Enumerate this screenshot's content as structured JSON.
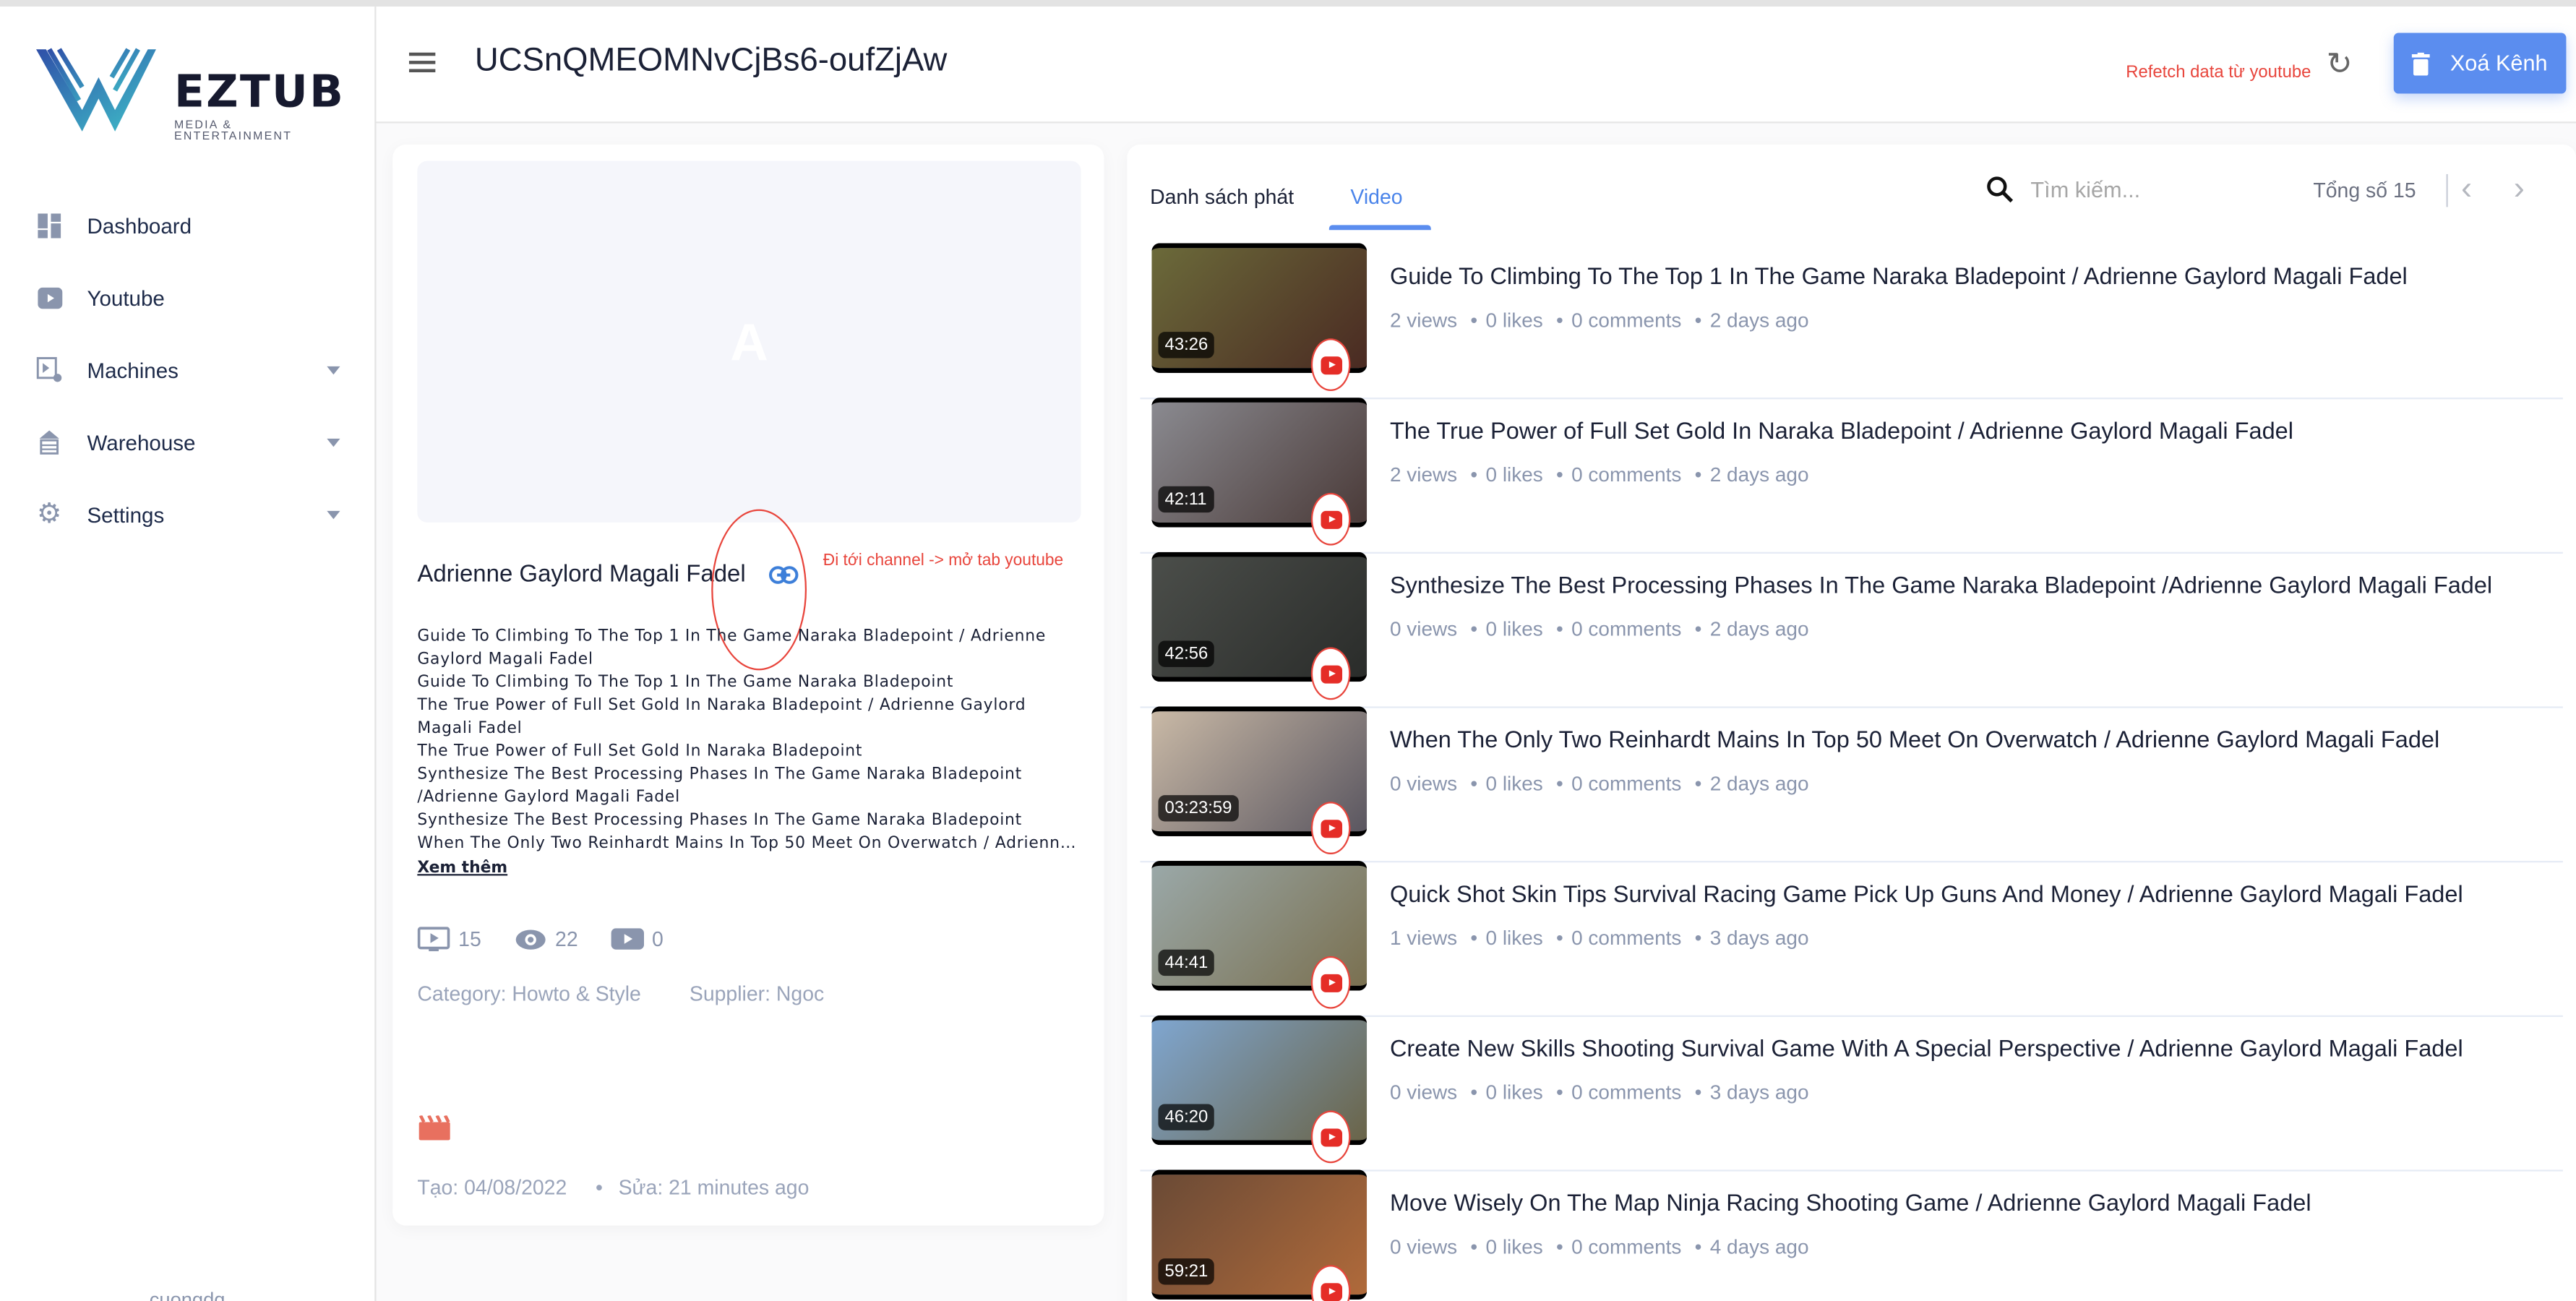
{
  "sidebar": {
    "logo": {
      "name": "EZTUB",
      "tagline": "MEDIA & ENTERTAINMENT"
    },
    "items": [
      {
        "label": "Dashboard",
        "icon": "dashboard-icon"
      },
      {
        "label": "Youtube",
        "icon": "youtube-icon"
      },
      {
        "label": "Machines",
        "icon": "machines-icon",
        "expandable": true
      },
      {
        "label": "Warehouse",
        "icon": "warehouse-icon",
        "expandable": true
      },
      {
        "label": "Settings",
        "icon": "gear-icon",
        "expandable": true
      }
    ],
    "user": "cuongdq"
  },
  "header": {
    "title": "UCSnQMEOMNvCjBs6-oufZjAw",
    "refetch_note": "Refetch data từ youtube",
    "delete_label": "Xoá Kênh"
  },
  "channel": {
    "avatar_letter": "A",
    "name": "Adrienne Gaylord Magali Fadel",
    "link_note": "Đi tới channel -> mở tab youtube",
    "description_lines": [
      "Guide To Climbing To The Top 1 In The Game Naraka Bladepoint / Adrienne",
      "Gaylord Magali Fadel",
      "Guide To Climbing To The Top 1 In The Game Naraka Bladepoint",
      "The True Power of Full Set Gold In Naraka Bladepoint / Adrienne Gaylord",
      "Magali Fadel",
      "The True Power of Full Set Gold In Naraka Bladepoint",
      "Synthesize The Best Processing Phases In The Game Naraka Bladepoint",
      "/Adrienne Gaylord Magali Fadel",
      "Synthesize The Best Processing Phases In The Game Naraka Bladepoint",
      "When The Only Two Reinhardt Mains In Top 50 Meet On Overwatch / Adrienne Gaylord Magali Fadel"
    ],
    "more_label": "Xem thêm",
    "stats": {
      "videos": "15",
      "views": "22",
      "subscribers": "0"
    },
    "category": "Category: Howto & Style",
    "supplier": "Supplier: Ngoc",
    "created": "Tạo: 04/08/2022",
    "updated": "Sửa: 21 minutes ago"
  },
  "videos_panel": {
    "tabs": [
      {
        "label": "Danh sách phát",
        "active": false
      },
      {
        "label": "Video",
        "active": true
      }
    ],
    "search_placeholder": "Tìm kiếm...",
    "total": "Tổng số 15",
    "videos": [
      {
        "title": "Guide To Climbing To The Top 1 In The Game Naraka Bladepoint / Adrienne Gaylord Magali Fadel",
        "duration": "43:26",
        "views": "2 views",
        "likes": "0 likes",
        "comments": "0 comments",
        "ago": "2 days ago",
        "thumb": [
          "#6b6a3a",
          "#4a2a22"
        ]
      },
      {
        "title": "The True Power of Full Set Gold In Naraka Bladepoint / Adrienne Gaylord Magali Fadel",
        "duration": "42:11",
        "views": "2 views",
        "likes": "0 likes",
        "comments": "0 comments",
        "ago": "2 days ago",
        "thumb": [
          "#8a8a90",
          "#4a3a38"
        ]
      },
      {
        "title": "Synthesize The Best Processing Phases In The Game Naraka Bladepoint /Adrienne Gaylord Magali Fadel",
        "duration": "42:56",
        "views": "0 views",
        "likes": "0 likes",
        "comments": "0 comments",
        "ago": "2 days ago",
        "thumb": [
          "#4b4e4a",
          "#2a2c2a"
        ]
      },
      {
        "title": "When The Only Two Reinhardt Mains In Top 50 Meet On Overwatch / Adrienne Gaylord Magali Fadel",
        "duration": "03:23:59",
        "views": "0 views",
        "likes": "0 likes",
        "comments": "0 comments",
        "ago": "2 days ago",
        "thumb": [
          "#c9b9a6",
          "#5a5660"
        ]
      },
      {
        "title": "Quick Shot Skin Tips Survival Racing Game Pick Up Guns And Money / Adrienne Gaylord Magali Fadel",
        "duration": "44:41",
        "views": "1 views",
        "likes": "0 likes",
        "comments": "0 comments",
        "ago": "3 days ago",
        "thumb": [
          "#9aa8a8",
          "#7a7050"
        ]
      },
      {
        "title": "Create New Skills Shooting Survival Game With A Special Perspective / Adrienne Gaylord Magali Fadel",
        "duration": "46:20",
        "views": "0 views",
        "likes": "0 likes",
        "comments": "0 comments",
        "ago": "3 days ago",
        "thumb": [
          "#7fa6d0",
          "#6a6448"
        ]
      },
      {
        "title": "Move Wisely On The Map Ninja Racing Shooting Game / Adrienne Gaylord Magali Fadel",
        "duration": "59:21",
        "views": "0 views",
        "likes": "0 likes",
        "comments": "0 comments",
        "ago": "4 days ago",
        "thumb": [
          "#6a4a36",
          "#b06a3a"
        ]
      }
    ]
  },
  "colors": {
    "accent": "#5b8def",
    "annotation": "#e8453c",
    "muted": "#8a95ad"
  }
}
